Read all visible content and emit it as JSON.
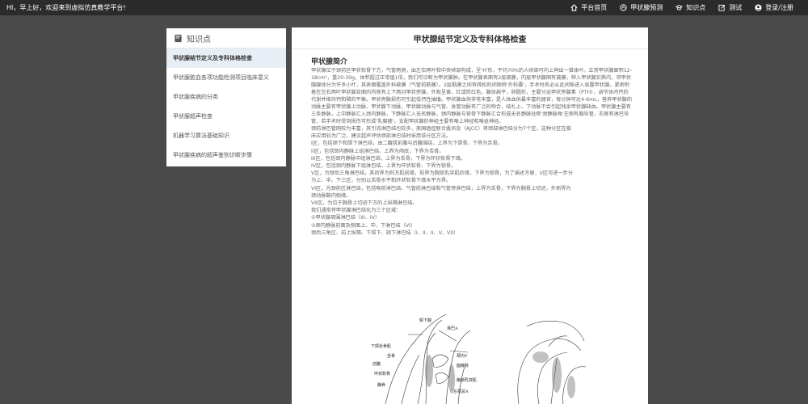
{
  "topbar": {
    "greeting": "HI，早上好，欢迎来到虚拟仿真教学平台!",
    "nav": [
      {
        "label": "平台首页",
        "icon": "home-icon"
      },
      {
        "label": "甲状腺预测",
        "icon": "predict-icon"
      },
      {
        "label": "知识点",
        "icon": "knowledge-icon"
      },
      {
        "label": "测试",
        "icon": "edit-icon"
      },
      {
        "label": "登录/注册",
        "icon": "user-icon"
      }
    ]
  },
  "sidebar": {
    "title": "知识点",
    "items": [
      {
        "label": "甲状腺结节定义及专科体格检查",
        "active": true
      },
      {
        "label": "甲状腺脏血各项功能检测项目临床意义",
        "active": false
      },
      {
        "label": "甲状腺疾病的分类",
        "active": false
      },
      {
        "label": "甲状腺超声检查",
        "active": false
      },
      {
        "label": "机器学习算法基础知识",
        "active": false
      },
      {
        "label": "甲状腺疾病的超声鉴别诊断步骤",
        "active": false
      }
    ]
  },
  "main": {
    "title": "甲状腺结节定义及专科体格检查",
    "section_title": "甲状腺简介",
    "paragraph": "甲状腺位于颈前区甲状软骨下方，气管两侧，由左右两叶和中央峡部构成，呈'H'形，平均70%的人峡部可向上伸出一锥体叶。正常甲状腺面积12-18cm²，重20-30g，体积超过正常值1倍，我们可诊断为甲状腺肿。在甲状腺表面有2层被膜，内层甲状腺固有被膜，伸入甲状腺实质内，将甲状腺腺体分为许多小叶，其表面覆盖外科被膜（气管前筋膜）。2层筋膜之间有疏松的间隙称'外科囊'，手术时务必从此间隙进入显露甲状腺。紧密附着在左右两叶甲状腺背面的内侧有上下两对甲状旁腺，外观呈黄、红或棕红色，腺体扁平，卵圆形，主要分泌甲状旁腺素（PTH），调节体内钙的代谢并维持钙和磷的平衡。甲状旁腺损伤可引起低钙性抽搐。甲状腺血供非常丰富，是人体血供最丰富的器官，每分钟可达4-6mL，营养甲状腺的动脉主要有甲状腺上动脉、甲状腺下动脉，甲状腺动脉与气管、食管动脉有广泛的吻合，结扎上、下动脉不会引起残余甲状腺缺血。甲状腺主要有三条静脉，上中静脉汇入颈内静脉，下静脉汇入无名静脉，颈内静脉与锁骨下静脉汇合形成无名静脉处称'颈静脉角'左侧有胸导管，右侧有淋巴导管，若手术时受到损伤可形成'乳糜瘘'。支配甲状腺的神经主要有喉上神经和喉返神经。",
    "lines": [
      "颈前淋巴管网较为丰富，其引流淋巴结也较多，美国癌症联合委员会（AJCC）将颈部淋巴结分为7个区，这种分区在临",
      "床应用较为广泛，建议超声评估颈部淋巴结时采用该分区方法。",
      "I区，包括颏下和颌下淋巴结，由二腹肌前腹与后腹围绕，上界为下颌骨，下界为舌骨。",
      "II区，包括颈内静脉上组淋巴结，上界为颅底，下界为舌骨。",
      "III区，包括颈内静脉中组淋巴结，上界为舌骨，下界为环状软骨下缘。",
      "IV区，包括颈内静脉下组淋巴结，上界为环状软骨，下界为锁骨。",
      "V区，为颈后三角淋巴结，其后界为斜方肌前缘，前界为胸锁乳突肌后缘，下界为锁骨，为了描述方便，V区可进一步分",
      "为上、中、下三区，分别以舌骨水平和环状软骨下缘水平为界。",
      "VI区，为颈前区淋巴结，包括喉前淋巴结、气管前淋巴结和气管旁淋巴结，上界为舌骨，下界为胸骨上切迹，外侧界为",
      "颈动脉鞘内侧缘。",
      "VII区，为位于胸骨上切迹下方的上纵隔淋巴结。",
      "我们通常将甲状腺淋巴结化为三个区域：",
      "①甲状腺周围淋巴结（III、IV）",
      "②颈内静脉前面及侧面上、中、下淋巴结（VI）",
      "颈后三角区、前上纵隔、下颌下、颏下淋巴结（I、II、II、V、VII）"
    ],
    "figure_labels": [
      "颏下腺",
      "淋巴A",
      "下颌舌骨肌",
      "舌骨",
      "颈内V",
      "前腹",
      "面静脉",
      "环状软骨",
      "胸锁乳突肌",
      "胸骨",
      "左颈总A"
    ]
  }
}
